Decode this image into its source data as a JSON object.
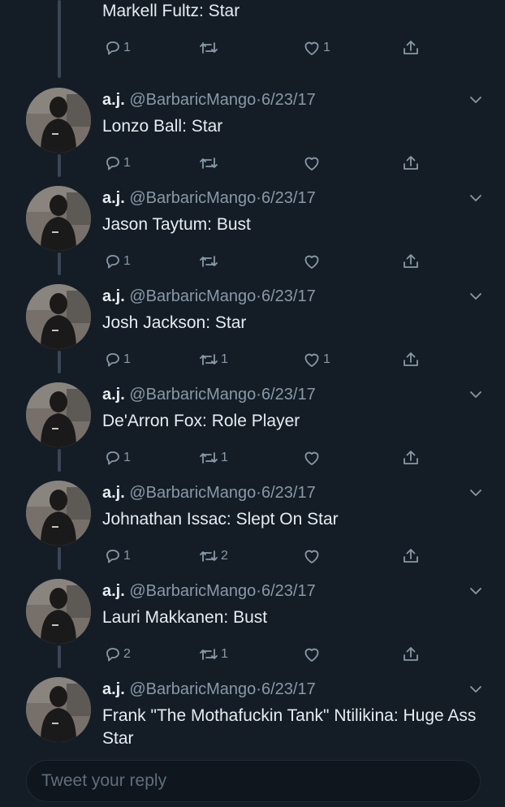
{
  "top_tweet": {
    "body": "Markell Fultz: Star",
    "replies": "1",
    "retweets": "",
    "likes": "1"
  },
  "tweets": [
    {
      "display_name": "a.j.",
      "handle": "@BarbaricMango",
      "date": "6/23/17",
      "body": "Lonzo Ball: Star",
      "replies": "1",
      "retweets": "",
      "likes": ""
    },
    {
      "display_name": "a.j.",
      "handle": "@BarbaricMango",
      "date": "6/23/17",
      "body": "Jason Taytum: Bust",
      "replies": "1",
      "retweets": "",
      "likes": ""
    },
    {
      "display_name": "a.j.",
      "handle": "@BarbaricMango",
      "date": "6/23/17",
      "body": "Josh Jackson: Star",
      "replies": "1",
      "retweets": "1",
      "likes": "1"
    },
    {
      "display_name": "a.j.",
      "handle": "@BarbaricMango",
      "date": "6/23/17",
      "body": "De'Arron Fox: Role Player",
      "replies": "1",
      "retweets": "1",
      "likes": ""
    },
    {
      "display_name": "a.j.",
      "handle": "@BarbaricMango",
      "date": "6/23/17",
      "body": "Johnathan Issac: Slept On Star",
      "replies": "1",
      "retweets": "2",
      "likes": ""
    },
    {
      "display_name": "a.j.",
      "handle": "@BarbaricMango",
      "date": "6/23/17",
      "body": "Lauri Makkanen: Bust",
      "replies": "2",
      "retweets": "1",
      "likes": ""
    },
    {
      "display_name": "a.j.",
      "handle": "@BarbaricMango",
      "date": "6/23/17",
      "body": "Frank \"The Mothafuckin Tank\" Ntilikina: Huge Ass Star",
      "replies": "",
      "retweets": "",
      "likes": ""
    }
  ],
  "composer": {
    "placeholder": "Tweet your reply"
  },
  "icons": {
    "reply": "reply-icon",
    "retweet": "retweet-icon",
    "like": "heart-icon",
    "share": "share-icon",
    "caret": "chevron-down-icon"
  },
  "colors": {
    "background": "#141d26",
    "text_primary": "#e6ecf0",
    "text_secondary": "#8899a6",
    "thread_line": "#3a4656"
  }
}
